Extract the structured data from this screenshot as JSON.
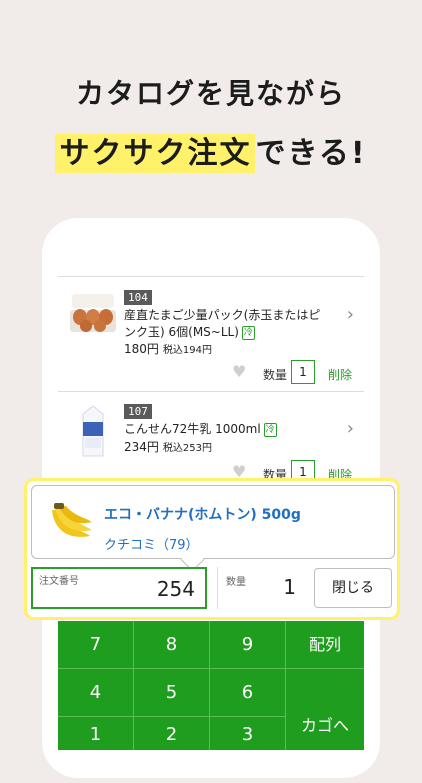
{
  "headline": {
    "line1": "カタログを見ながら",
    "line2_highlight": "サクサク注文",
    "line2_rest": "できる!"
  },
  "items": [
    {
      "number": "104",
      "name": "産直たまご少量パック(赤玉またはピンク玉) 6個(MS~LL)",
      "cold_badge": "冷",
      "price": "180円",
      "tax_price": "税込194円",
      "qty_label": "数量",
      "qty": "1",
      "delete": "削除"
    },
    {
      "number": "107",
      "name": "こんせん72牛乳 1000ml",
      "cold_badge": "冷",
      "price": "234円",
      "tax_price": "税込253円",
      "qty_label": "数量",
      "qty": "1",
      "delete": "削除"
    }
  ],
  "popup": {
    "product_name": "エコ・バナナ(ホムトン) 500g",
    "review": "クチコミ（79）",
    "order_label": "注文番号",
    "order_value": "254",
    "qty_label": "数量",
    "qty_value": "1",
    "close": "閉じる"
  },
  "keypad": {
    "keys": [
      "7",
      "8",
      "9",
      "配列",
      "4",
      "5",
      "6",
      "カゴへ",
      "1",
      "2",
      "3"
    ]
  },
  "colors": {
    "accent_green": "#1f9d1f",
    "highlight_yellow": "#fff26a",
    "link_blue": "#1f6fc2",
    "background": "#f1ecea"
  }
}
